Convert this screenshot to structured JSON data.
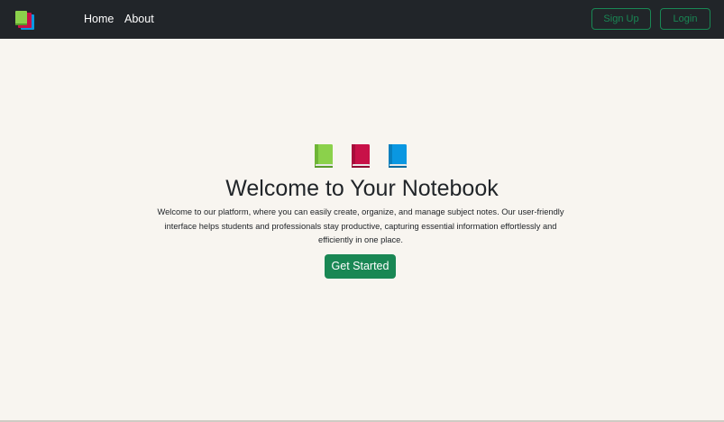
{
  "navbar": {
    "logo_icon": "books-logo-icon",
    "links": [
      {
        "label": "Home"
      },
      {
        "label": "About"
      }
    ],
    "signup_label": "Sign Up",
    "login_label": "Login"
  },
  "hero": {
    "icons": [
      "green-book-icon",
      "red-book-icon",
      "blue-book-icon"
    ],
    "title": "Welcome to Your Notebook",
    "description": "Welcome to our platform, where you can easily create, organize, and manage subject notes. Our user-friendly interface helps students and professionals stay productive, capturing essential information effortlessly and efficiently in one place.",
    "cta_label": "Get Started"
  },
  "colors": {
    "navbar_bg": "#212529",
    "page_bg": "#f8f5f0",
    "accent_green": "#198754",
    "book_green": "#8bd14b",
    "book_red": "#c81148",
    "book_blue": "#0a97e1"
  }
}
